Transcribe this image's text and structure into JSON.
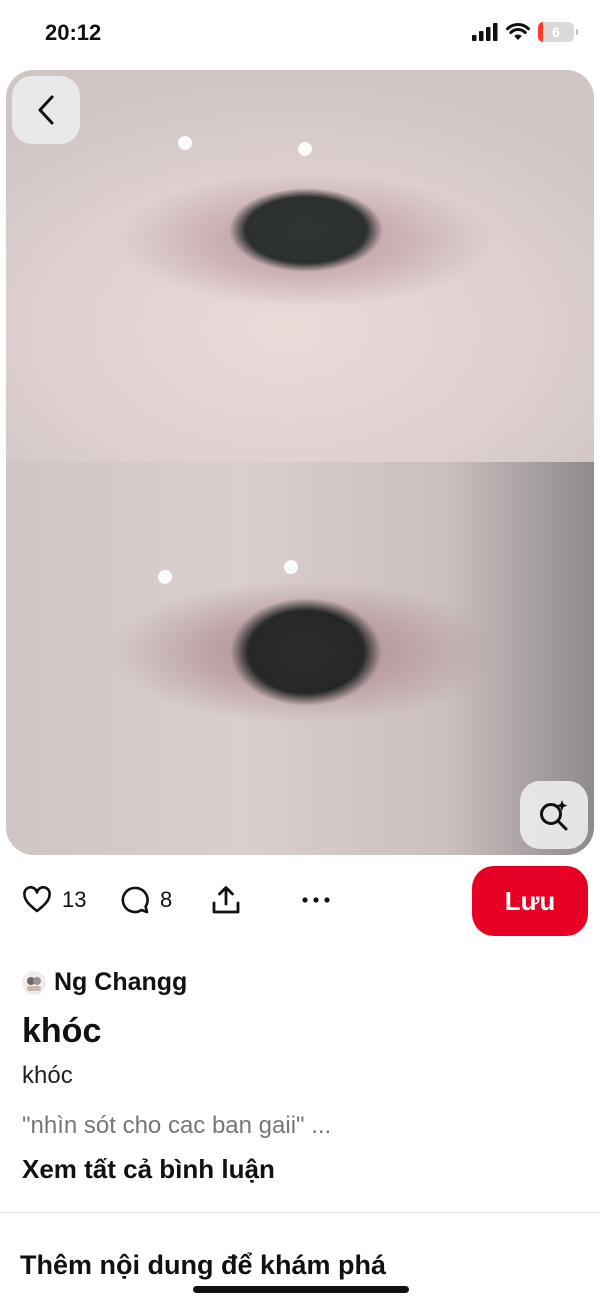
{
  "status_bar": {
    "time": "20:12",
    "battery_level": "6",
    "icons": [
      "signal-icon",
      "wifi-icon",
      "battery-icon"
    ],
    "battery_color": "#ff3b30"
  },
  "pin": {
    "image": {
      "icons": [
        "back-chevron-icon",
        "visual-search-icon"
      ]
    },
    "actions": {
      "like_count": "13",
      "comment_count": "8",
      "save_label": "Lưu",
      "icons": [
        "heart-icon",
        "comment-icon",
        "share-icon",
        "more-icon"
      ],
      "save_color": "#e60023"
    },
    "creator": {
      "name": "Ng Changg"
    },
    "title": "khóc",
    "description": "khóc",
    "comment_preview": "\"nhìn sót cho cac ban gaii\" ...",
    "see_all_comments": "Xem tất cả bình luận"
  },
  "more_section": {
    "title": "Thêm nội dung để khám phá"
  }
}
